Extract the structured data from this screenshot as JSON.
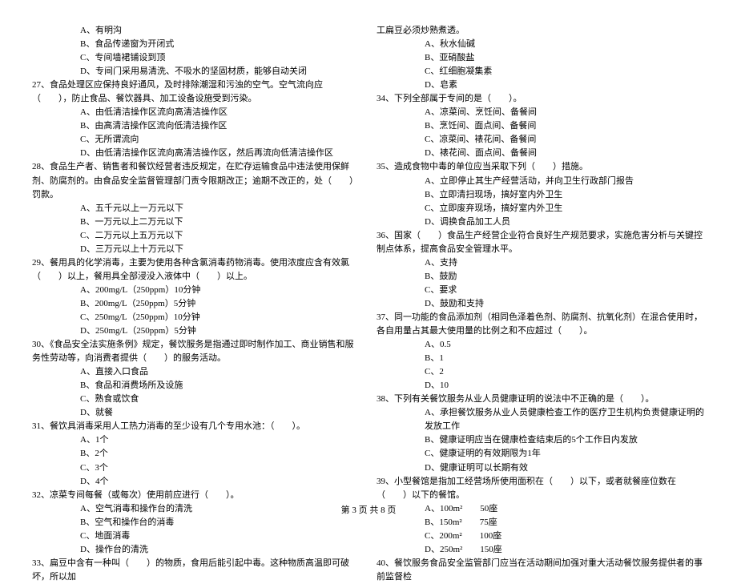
{
  "left": {
    "opt_a": "A、有明沟",
    "opt_b": "B、食品传递窗为开闭式",
    "opt_c": "C、专间墙裙铺设到顶",
    "opt_d": "D、专间门采用易清洗、不吸水的坚固材质，能够自动关闭",
    "q27": "27、食品处理区应保持良好通风，及时排除潮湿和污浊的空气。空气流向应（　　），防止食品、餐饮器具、加工设备设施受到污染。",
    "q27a": "A、由低清洁操作区流向高清洁操作区",
    "q27b": "B、由高清洁操作区流向低清洁操作区",
    "q27c": "C、无所谓流向",
    "q27d": "D、由低清洁操作区流向高清洁操作区，然后再流向低清洁操作区",
    "q28": "28、食品生产者、销售者和餐饮经营者违反规定，在贮存运输食品中违法使用保鲜剂、防腐剂的。由食品安全监督管理部门责令限期改正；逾期不改正的，处（　　）罚款。",
    "q28a": "A、五千元以上一万元以下",
    "q28b": "B、一万元以上二万元以下",
    "q28c": "C、二万元以上五万元以下",
    "q28d": "D、三万元以上十万元以下",
    "q29": "29、餐用具的化学消毒，主要为使用各种含氯消毒药物消毒。使用浓度应含有效氯（　　）以上，餐用具全部浸没入液体中（　　）以上。",
    "q29a": "A、200mg/L（250ppm）10分钟",
    "q29b": "B、200mg/L（250ppm）5分钟",
    "q29c": "C、250mg/L（250ppm）10分钟",
    "q29d": "D、250mg/L（250ppm）5分钟",
    "q30": "30、《食品安全法实施条例》规定，餐饮服务是指通过即时制作加工、商业销售和服务性劳动等，向消费者提供（　　）的服务活动。",
    "q30a": "A、直接入口食品",
    "q30b": "B、食品和消费场所及设施",
    "q30c": "C、熟食或饮食",
    "q30d": "D、就餐",
    "q31": "31、餐饮具消毒采用人工热力消毒的至少设有几个专用水池：（　　）。",
    "q31a": "A、1个",
    "q31b": "B、2个",
    "q31c": "C、3个",
    "q31d": "D、4个",
    "q32": "32、凉菜专间每餐（或每次）使用前应进行（　　）。",
    "q32a": "A、空气消毒和操作台的清洗",
    "q32b": "B、空气和操作台的消毒",
    "q32c": "C、地面消毒",
    "q32d": "D、操作台的清洗",
    "q33": "33、扁豆中含有一种叫（　　）的物质，食用后能引起中毒。这种物质高温即可破坏，所以加"
  },
  "right": {
    "cont": "工扁豆必须炒熟煮透。",
    "q33a": "A、秋水仙碱",
    "q33b": "B、亚硝酸盐",
    "q33c": "C、红细胞凝集素",
    "q33d": "D、皂素",
    "q34": "34、下列全部属于专间的是（　　）。",
    "q34a": "A、凉菜间、烹饪间、备餐间",
    "q34b": "B、烹饪间、面点间、备餐间",
    "q34c": "C、凉菜间、裱花间、备餐间",
    "q34d": "D、裱花间、面点间、备餐间",
    "q35": "35、造成食物中毒的单位应当采取下列（　　）措施。",
    "q35a": "A、立即停止其生产经营活动，并向卫生行政部门报告",
    "q35b": "B、立即清扫现场，搞好室内外卫生",
    "q35c": "C、立即废弃现场，搞好室内外卫生",
    "q35d": "D、调换食品加工人员",
    "q36": "36、国家（　　）食品生产经营企业符合良好生产规范要求，实施危害分析与关键控制点体系，提高食品安全管理水平。",
    "q36a": "A、支持",
    "q36b": "B、鼓励",
    "q36c": "C、要求",
    "q36d": "D、鼓励和支持",
    "q37": "37、同一功能的食品添加剂（相同色泽着色剂、防腐剂、抗氧化剂）在混合使用时，各自用量占其最大使用量的比例之和不应超过（　　）。",
    "q37a": "A、0.5",
    "q37b": "B、1",
    "q37c": "C、2",
    "q37d": "D、10",
    "q38": "38、下列有关餐饮服务从业人员健康证明的说法中不正确的是（　　）。",
    "q38a": "A、承担餐饮服务从业人员健康检查工作的医疗卫生机构负责健康证明的发放工作",
    "q38b": "B、健康证明应当在健康检查结束后的5个工作日内发放",
    "q38c": "C、健康证明的有效期限为1年",
    "q38d": "D、健康证明可以长期有效",
    "q39": "39、小型餐馆是指加工经营场所使用面积在（　　）以下，或者就餐座位数在（　　）以下的餐馆。",
    "q39a": "A、100m²　　50座",
    "q39b": "B、150m²　　75座",
    "q39c": "C、200m²　　100座",
    "q39d": "D、250m²　　150座",
    "q40": "40、餐饮服务食品安全监管部门应当在活动期间加强对重大活动餐饮服务提供者的事前监督检"
  },
  "footer": "第 3 页 共 8 页"
}
